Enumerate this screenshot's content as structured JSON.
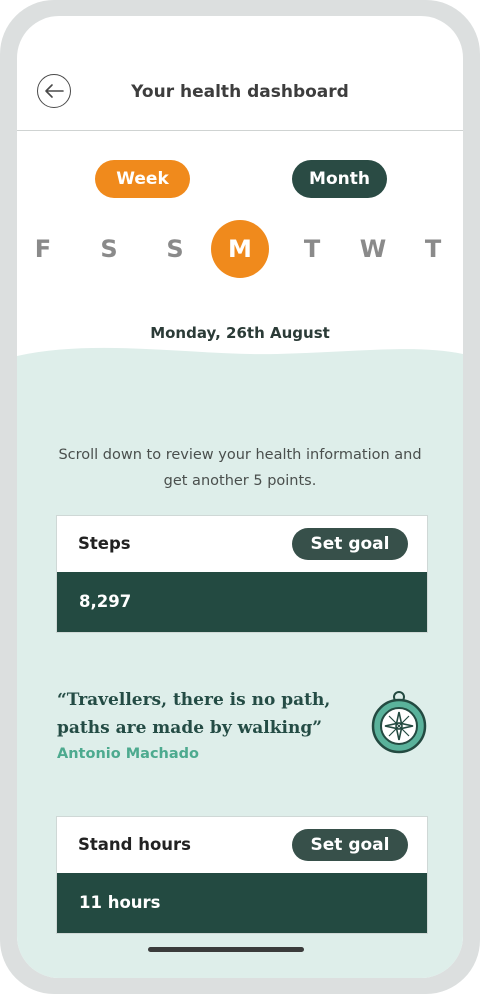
{
  "header": {
    "title": "Your health dashboard",
    "back_icon": "arrow-left-icon"
  },
  "period_toggle": {
    "week": "Week",
    "month": "Month",
    "selected": "Week",
    "accent_color": "#f08a1c",
    "secondary_color": "#2a4b44"
  },
  "days": [
    "F",
    "S",
    "S",
    "M",
    "T",
    "W",
    "T"
  ],
  "selected_day_index": 3,
  "date_label": "Monday, 26th August",
  "intro_text": "Scroll down to review your health information and get another 5 points.",
  "cards": [
    {
      "label": "Steps",
      "goal_button": "Set goal",
      "value": "8,297"
    },
    {
      "label": "Stand hours",
      "goal_button": "Set goal",
      "value": "11 hours"
    }
  ],
  "quote": {
    "text": "“Travellers, there is no path, paths are made by walking”",
    "author": "Antonio Machado",
    "icon": "compass-icon"
  },
  "colors": {
    "mint_background": "#deeeea",
    "dark_green": "#234a41",
    "author_green": "#4daa8f"
  }
}
